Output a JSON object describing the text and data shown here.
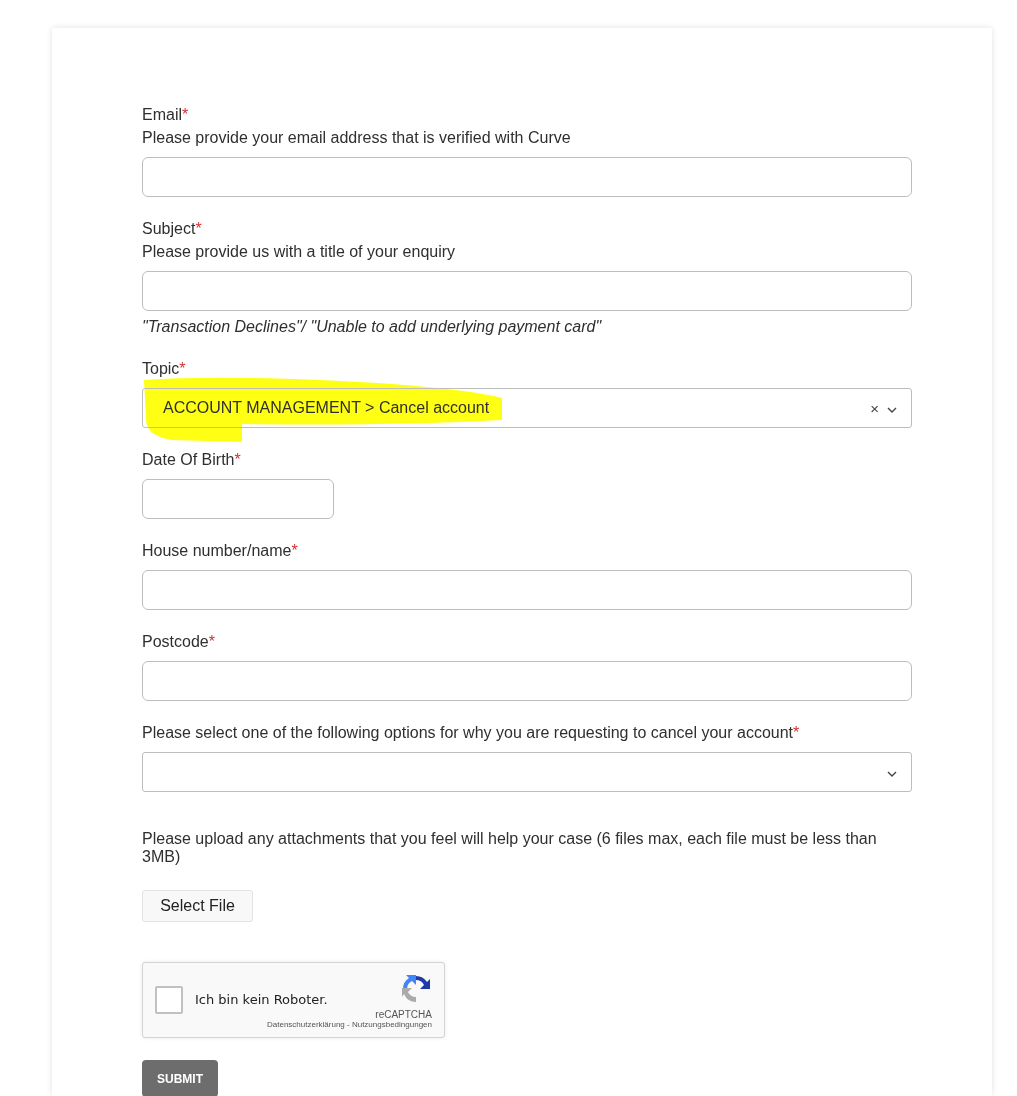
{
  "fields": [
    {
      "kind": "text",
      "label": "Email",
      "required_mark": "*",
      "help": "Please provide your email address that is verified with Curve"
    },
    {
      "kind": "text",
      "label": "Subject",
      "required_mark": "*",
      "help": "Please provide us with a title of your enquiry",
      "hint": "\"Transaction Declines\"/ \"Unable to add underlying payment card\""
    },
    {
      "kind": "select",
      "label": "Topic",
      "required_mark": "*",
      "value": "ACCOUNT MANAGEMENT > Cancel account",
      "clear_icon": "×",
      "highlighted": true
    },
    {
      "kind": "date",
      "label": "Date Of Birth",
      "required_mark": "*"
    },
    {
      "kind": "text",
      "label": "House number/name",
      "required_mark": "*"
    },
    {
      "kind": "text",
      "label": "Postcode",
      "required_mark": "*"
    },
    {
      "kind": "select",
      "label": "Please select one of the following options for why you are requesting to cancel your account",
      "required_mark": "*",
      "highlighted": false
    }
  ],
  "upload": {
    "text": "Please upload any attachments that you feel will help your case (6 files max, each file must be less than 3MB)",
    "button": "Select File"
  },
  "captcha": {
    "label": "Ich bin kein Roboter.",
    "checked": false,
    "brand": "reCAPTCHA",
    "links": [
      "Datenschutzerklärung",
      "Nutzungsbedingungen"
    ],
    "separator": "-"
  },
  "submit": "SUBMIT"
}
